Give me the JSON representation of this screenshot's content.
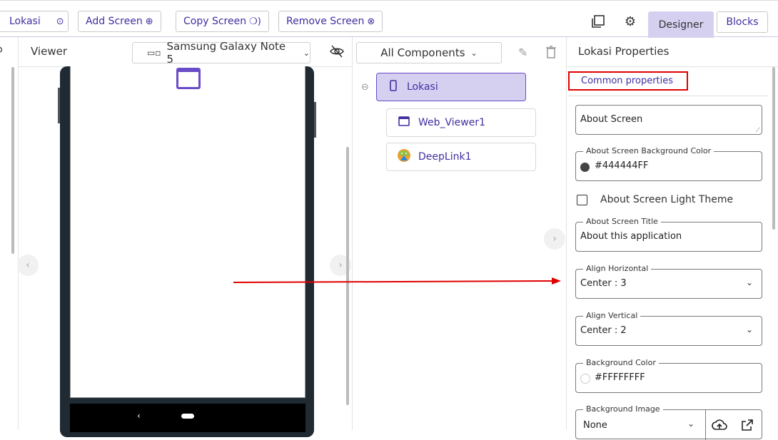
{
  "toolbar": {
    "screen_name": "Lokasi",
    "add_screen": "Add Screen",
    "copy_screen": "Copy Screen",
    "remove_screen": "Remove Screen",
    "designer_tab": "Designer",
    "blocks_tab": "Blocks"
  },
  "viewer": {
    "title": "Viewer",
    "device": "Samsung Galaxy Note 5"
  },
  "components": {
    "filter": "All Components",
    "items": [
      {
        "label": "Lokasi"
      },
      {
        "label": "Web_Viewer1"
      },
      {
        "label": "DeepLink1"
      }
    ]
  },
  "properties": {
    "title": "Lokasi Properties",
    "section_label": "Common properties",
    "about_screen": "About Screen",
    "bg_color_label": "About Screen Background Color",
    "bg_color_value": "#444444FF",
    "light_theme_label": "About Screen Light Theme",
    "title_label": "About Screen Title",
    "title_value": "About this application",
    "align_h_label": "Align Horizontal",
    "align_h_value": "Center : 3",
    "align_v_label": "Align Vertical",
    "align_v_value": "Center : 2",
    "background_color_label": "Background Color",
    "background_color_value": "#FFFFFFFF",
    "background_image_label": "Background Image",
    "background_image_value": "None"
  },
  "colors": {
    "accent": "#3f2fa0",
    "selected": "#d5d0f0",
    "annotation": "#e00000"
  }
}
